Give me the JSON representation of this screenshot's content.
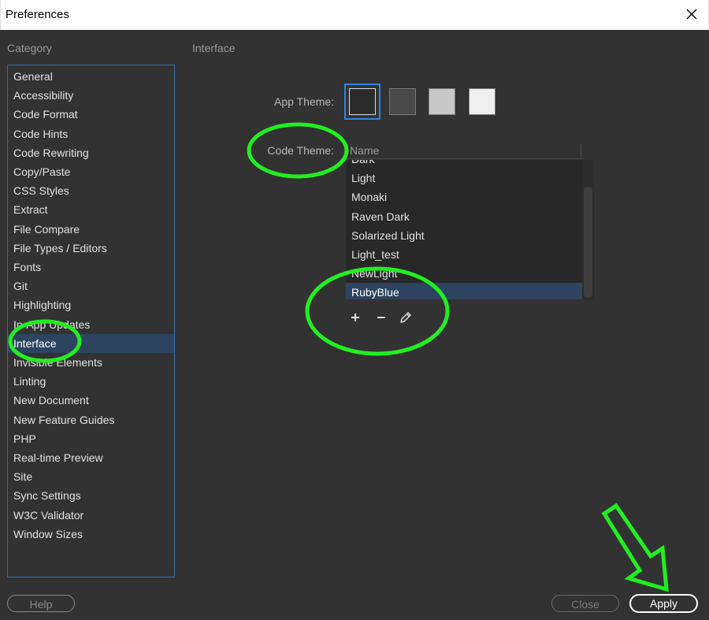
{
  "window": {
    "title": "Preferences",
    "close_icon": "close-icon"
  },
  "category": {
    "heading": "Category",
    "items": [
      "General",
      "Accessibility",
      "Code Format",
      "Code Hints",
      "Code Rewriting",
      "Copy/Paste",
      "CSS Styles",
      "Extract",
      "File Compare",
      "File Types / Editors",
      "Fonts",
      "Git",
      "Highlighting",
      "In-App Updates",
      "Interface",
      "Invisible Elements",
      "Linting",
      "New Document",
      "New Feature Guides",
      "PHP",
      "Real-time Preview",
      "Site",
      "Sync Settings",
      "W3C Validator",
      "Window Sizes"
    ],
    "selected": "Interface"
  },
  "panel": {
    "heading": "Interface",
    "app_theme_label": "App Theme:",
    "app_theme_swatches": [
      "#2b2b2b",
      "#494949",
      "#c8c8c8",
      "#f0f0f0"
    ],
    "app_theme_selected_index": 0,
    "code_theme_label": "Code Theme:",
    "code_theme_column": "Name",
    "code_themes": [
      "Dark",
      "Light",
      "Monaki",
      "Raven Dark",
      "Solarized Light",
      "Light_test",
      "NewLight",
      "RubyBlue"
    ],
    "code_theme_selected": "RubyBlue",
    "add_icon": "plus-icon",
    "remove_icon": "minus-icon",
    "edit_icon": "pencil-icon"
  },
  "footer": {
    "help_label": "Help",
    "close_label": "Close",
    "apply_label": "Apply"
  },
  "colors": {
    "background": "#323232",
    "selection": "#2d4460",
    "focus_border": "#2d84e0",
    "annotation": "#22ee22"
  }
}
